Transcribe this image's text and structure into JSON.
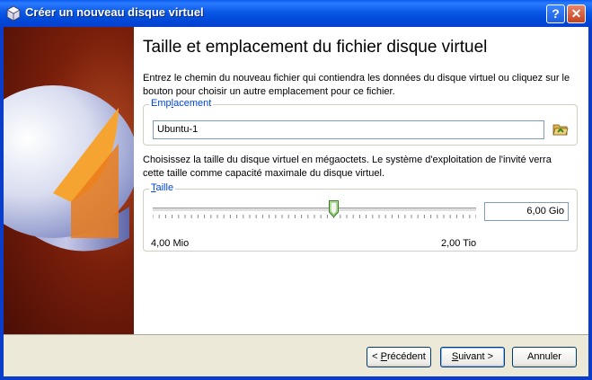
{
  "window": {
    "title": "Créer un nouveau disque virtuel"
  },
  "titlebar_buttons": {
    "help": "?",
    "close": "✕"
  },
  "page": {
    "heading": "Taille et emplacement du fichier disque virtuel",
    "location_description": "Entrez le chemin du nouveau fichier qui contiendra les données du disque virtuel ou cliquez sur le bouton pour choisir un autre emplacement pour ce fichier.",
    "location_group": {
      "label_pre": "Emp",
      "label_accel": "l",
      "label_post": "acement",
      "value": "Ubuntu-1"
    },
    "size_description": "Choisissez la taille du disque virtuel en mégaoctets. Le système d'exploitation de l'invité verra cette taille comme capacité maximale du disque virtuel.",
    "size_group": {
      "label_accel": "T",
      "label_post": "aille",
      "min_label": "4,00 Mio",
      "max_label": "2,00 Tio",
      "value": "6,00 Gio",
      "slider_fraction": 0.56
    }
  },
  "buttons": {
    "back": {
      "pre": "< ",
      "accel": "P",
      "post": "récédent"
    },
    "next": {
      "accel": "S",
      "post": "uivant >"
    },
    "cancel": "Annuler"
  },
  "icons": {
    "app": "virtualbox-icon",
    "folder": "folder-open-icon",
    "side_art": "disk-art"
  }
}
